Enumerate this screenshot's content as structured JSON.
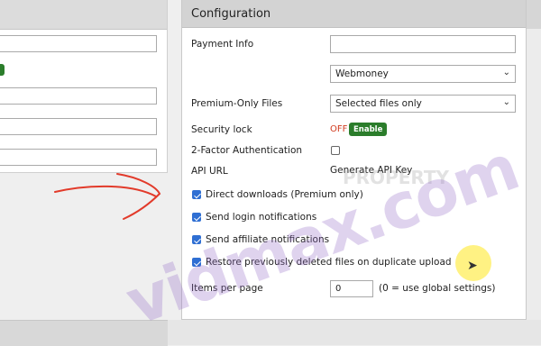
{
  "config": {
    "title": "Configuration",
    "payment_info_label": "Payment Info",
    "payment_info_value": "",
    "payment_method_selected": "Webmoney",
    "premium_only_label": "Premium-Only Files",
    "premium_only_selected": "Selected files only",
    "security_lock_label": "Security lock",
    "security_lock_status": "OFF",
    "enable_label": "Enable",
    "two_factor_label": "2-Factor Authentication",
    "api_url_label": "API URL",
    "generate_api_key": "Generate API Key",
    "direct_downloads_label": "Direct downloads (Premium only)",
    "send_login_label": "Send login notifications",
    "send_affiliate_label": "Send affiliate notifications",
    "restore_label": "Restore previously deleted files on duplicate upload",
    "items_per_page_label": "Items per page",
    "items_per_page_value": "0",
    "items_per_page_note": "(0 = use global settings)"
  },
  "watermark": {
    "main": "vidmax.com",
    "secondary": "PROPERTY"
  },
  "colors": {
    "enable_green": "#2b7d2b",
    "off_red": "#d13b1f",
    "checkbox_blue": "#2f6fd3"
  }
}
